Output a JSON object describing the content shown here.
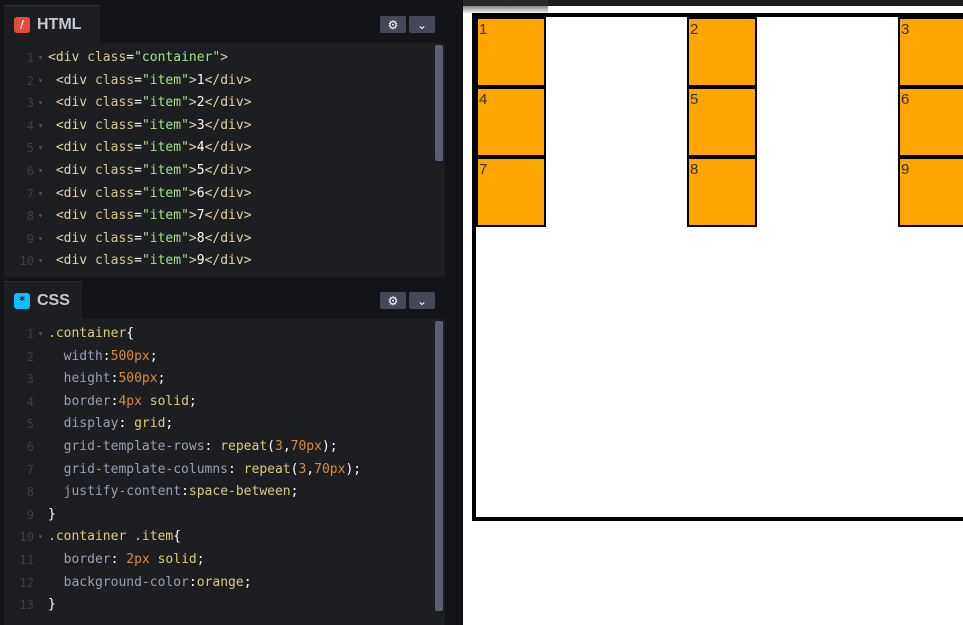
{
  "html_panel": {
    "title": "HTML",
    "icon": "/",
    "settings_icon": "⚙",
    "collapse_icon": "⌄",
    "lines": [
      {
        "n": "1",
        "parts": [
          [
            "c-tag",
            "<div "
          ],
          [
            "c-attr",
            "class"
          ],
          [
            "c-pun",
            "="
          ],
          [
            "c-str",
            "\"container\""
          ],
          [
            "c-tag",
            ">"
          ]
        ]
      },
      {
        "n": "2",
        "parts": [
          [
            "c-tag",
            " <div "
          ],
          [
            "c-attr",
            "class"
          ],
          [
            "c-pun",
            "="
          ],
          [
            "c-str",
            "\"item\""
          ],
          [
            "c-tag",
            ">"
          ],
          [
            "c-txt",
            "1"
          ],
          [
            "c-tag",
            "</div>"
          ]
        ]
      },
      {
        "n": "3",
        "parts": [
          [
            "c-tag",
            " <div "
          ],
          [
            "c-attr",
            "class"
          ],
          [
            "c-pun",
            "="
          ],
          [
            "c-str",
            "\"item\""
          ],
          [
            "c-tag",
            ">"
          ],
          [
            "c-txt",
            "2"
          ],
          [
            "c-tag",
            "</div>"
          ]
        ]
      },
      {
        "n": "4",
        "parts": [
          [
            "c-tag",
            " <div "
          ],
          [
            "c-attr",
            "class"
          ],
          [
            "c-pun",
            "="
          ],
          [
            "c-str",
            "\"item\""
          ],
          [
            "c-tag",
            ">"
          ],
          [
            "c-txt",
            "3"
          ],
          [
            "c-tag",
            "</div>"
          ]
        ]
      },
      {
        "n": "5",
        "parts": [
          [
            "c-tag",
            " <div "
          ],
          [
            "c-attr",
            "class"
          ],
          [
            "c-pun",
            "="
          ],
          [
            "c-str",
            "\"item\""
          ],
          [
            "c-tag",
            ">"
          ],
          [
            "c-txt",
            "4"
          ],
          [
            "c-tag",
            "</div>"
          ]
        ]
      },
      {
        "n": "6",
        "parts": [
          [
            "c-tag",
            " <div "
          ],
          [
            "c-attr",
            "class"
          ],
          [
            "c-pun",
            "="
          ],
          [
            "c-str",
            "\"item\""
          ],
          [
            "c-tag",
            ">"
          ],
          [
            "c-txt",
            "5"
          ],
          [
            "c-tag",
            "</div>"
          ]
        ]
      },
      {
        "n": "7",
        "parts": [
          [
            "c-tag",
            " <div "
          ],
          [
            "c-attr",
            "class"
          ],
          [
            "c-pun",
            "="
          ],
          [
            "c-str",
            "\"item\""
          ],
          [
            "c-tag",
            ">"
          ],
          [
            "c-txt",
            "6"
          ],
          [
            "c-tag",
            "</div>"
          ]
        ]
      },
      {
        "n": "8",
        "parts": [
          [
            "c-tag",
            " <div "
          ],
          [
            "c-attr",
            "class"
          ],
          [
            "c-pun",
            "="
          ],
          [
            "c-str",
            "\"item\""
          ],
          [
            "c-tag",
            ">"
          ],
          [
            "c-txt",
            "7"
          ],
          [
            "c-tag",
            "</div>"
          ]
        ]
      },
      {
        "n": "9",
        "parts": [
          [
            "c-tag",
            " <div "
          ],
          [
            "c-attr",
            "class"
          ],
          [
            "c-pun",
            "="
          ],
          [
            "c-str",
            "\"item\""
          ],
          [
            "c-tag",
            ">"
          ],
          [
            "c-txt",
            "8"
          ],
          [
            "c-tag",
            "</div>"
          ]
        ]
      },
      {
        "n": "10",
        "parts": [
          [
            "c-tag",
            " <div "
          ],
          [
            "c-attr",
            "class"
          ],
          [
            "c-pun",
            "="
          ],
          [
            "c-str",
            "\"item\""
          ],
          [
            "c-tag",
            ">"
          ],
          [
            "c-txt",
            "9"
          ],
          [
            "c-tag",
            "</div>"
          ]
        ]
      }
    ]
  },
  "css_panel": {
    "title": "CSS",
    "icon": "*",
    "settings_icon": "⚙",
    "collapse_icon": "⌄",
    "lines": [
      {
        "n": "1",
        "parts": [
          [
            "c-sel",
            ".container"
          ],
          [
            "c-pun",
            "{"
          ]
        ]
      },
      {
        "n": "2",
        "parts": [
          [
            "c-prop",
            "  width"
          ],
          [
            "c-pun",
            ":"
          ],
          [
            "c-num",
            "500px"
          ],
          [
            "c-pun",
            ";"
          ]
        ]
      },
      {
        "n": "3",
        "parts": [
          [
            "c-prop",
            "  height"
          ],
          [
            "c-pun",
            ":"
          ],
          [
            "c-num",
            "500px"
          ],
          [
            "c-pun",
            ";"
          ]
        ]
      },
      {
        "n": "4",
        "parts": [
          [
            "c-prop",
            "  border"
          ],
          [
            "c-pun",
            ":"
          ],
          [
            "c-num",
            "4px"
          ],
          [
            "c-val",
            " solid"
          ],
          [
            "c-pun",
            ";"
          ]
        ]
      },
      {
        "n": "5",
        "parts": [
          [
            "c-prop",
            "  display"
          ],
          [
            "c-pun",
            ": "
          ],
          [
            "c-val",
            "grid"
          ],
          [
            "c-pun",
            ";"
          ]
        ]
      },
      {
        "n": "6",
        "parts": [
          [
            "c-prop",
            "  grid-template-rows"
          ],
          [
            "c-pun",
            ": "
          ],
          [
            "c-val",
            "repeat"
          ],
          [
            "c-pun",
            "("
          ],
          [
            "c-num",
            "3"
          ],
          [
            "c-pun",
            ","
          ],
          [
            "c-num",
            "70px"
          ],
          [
            "c-pun",
            ");"
          ]
        ]
      },
      {
        "n": "7",
        "parts": [
          [
            "c-prop",
            "  grid-template-columns"
          ],
          [
            "c-pun",
            ": "
          ],
          [
            "c-val",
            "repeat"
          ],
          [
            "c-pun",
            "("
          ],
          [
            "c-num",
            "3"
          ],
          [
            "c-pun",
            ","
          ],
          [
            "c-num",
            "70px"
          ],
          [
            "c-pun",
            ");"
          ]
        ]
      },
      {
        "n": "8",
        "parts": [
          [
            "c-prop",
            "  justify-content"
          ],
          [
            "c-pun",
            ":"
          ],
          [
            "c-val",
            "space-between"
          ],
          [
            "c-pun",
            ";"
          ]
        ]
      },
      {
        "n": "9",
        "parts": [
          [
            "c-pun",
            "}"
          ]
        ]
      },
      {
        "n": "10",
        "parts": [
          [
            "c-sel",
            ".container .item"
          ],
          [
            "c-pun",
            "{"
          ]
        ]
      },
      {
        "n": "11",
        "parts": [
          [
            "c-prop",
            "  border"
          ],
          [
            "c-pun",
            ": "
          ],
          [
            "c-num",
            "2px"
          ],
          [
            "c-val",
            " solid"
          ],
          [
            "c-pun",
            ";"
          ]
        ]
      },
      {
        "n": "12",
        "parts": [
          [
            "c-prop",
            "  background-color"
          ],
          [
            "c-pun",
            ":"
          ],
          [
            "c-val",
            "orange"
          ],
          [
            "c-pun",
            ";"
          ]
        ]
      },
      {
        "n": "13",
        "parts": [
          [
            "c-pun",
            "}"
          ]
        ]
      }
    ]
  },
  "preview": {
    "items": [
      "1",
      "2",
      "3",
      "4",
      "5",
      "6",
      "7",
      "8",
      "9"
    ]
  },
  "colors": {
    "item_background": "#ffa500",
    "html_icon": "#e44d3a",
    "css_icon": "#0ebeff"
  }
}
